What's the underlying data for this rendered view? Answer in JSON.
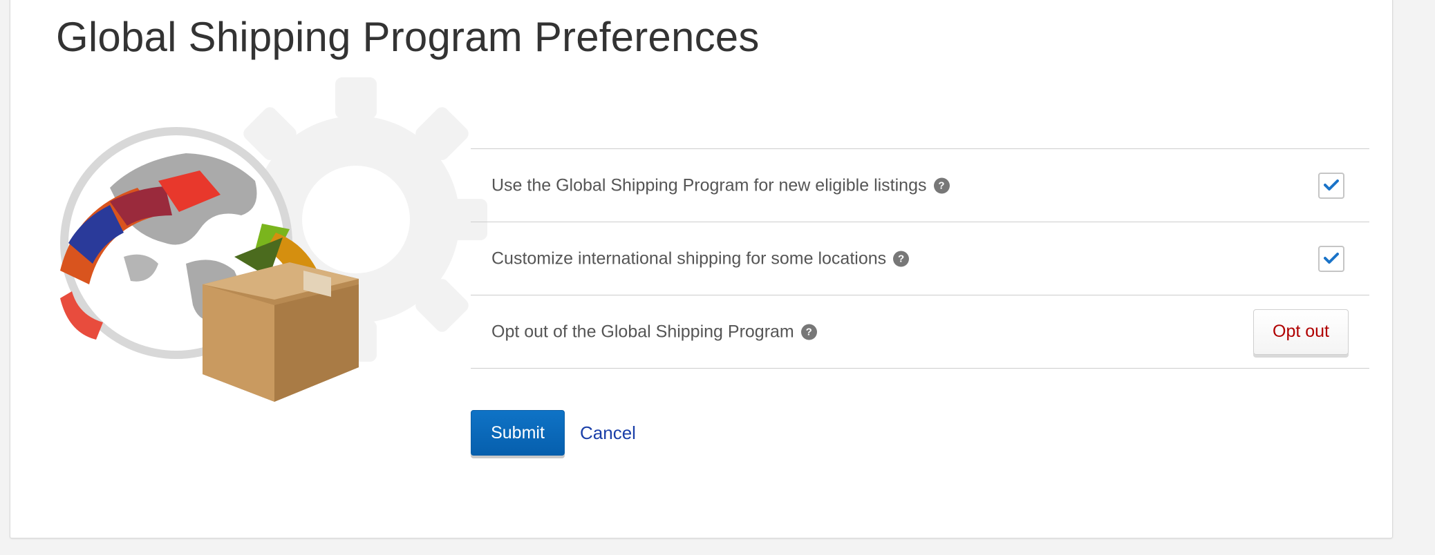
{
  "page": {
    "title": "Global Shipping Program Preferences"
  },
  "preferences": {
    "items": [
      {
        "label": "Use the Global Shipping Program for new eligible listings",
        "help": "?",
        "control": "checkbox",
        "checked": true
      },
      {
        "label": "Customize international shipping for some locations",
        "help": "?",
        "control": "checkbox",
        "checked": true
      },
      {
        "label": "Opt out of the Global Shipping Program",
        "help": "?",
        "control": "button",
        "button_label": "Opt out"
      }
    ]
  },
  "actions": {
    "submit_label": "Submit",
    "cancel_label": "Cancel"
  },
  "icons": {
    "illustration": "globe-with-package-illustration",
    "help": "question-circle-icon",
    "check": "checkmark-icon"
  },
  "colors": {
    "primary_button": "#0b6bbf",
    "link": "#1a3fa8",
    "optout_text": "#b00000",
    "checkmark": "#1a73c8"
  }
}
